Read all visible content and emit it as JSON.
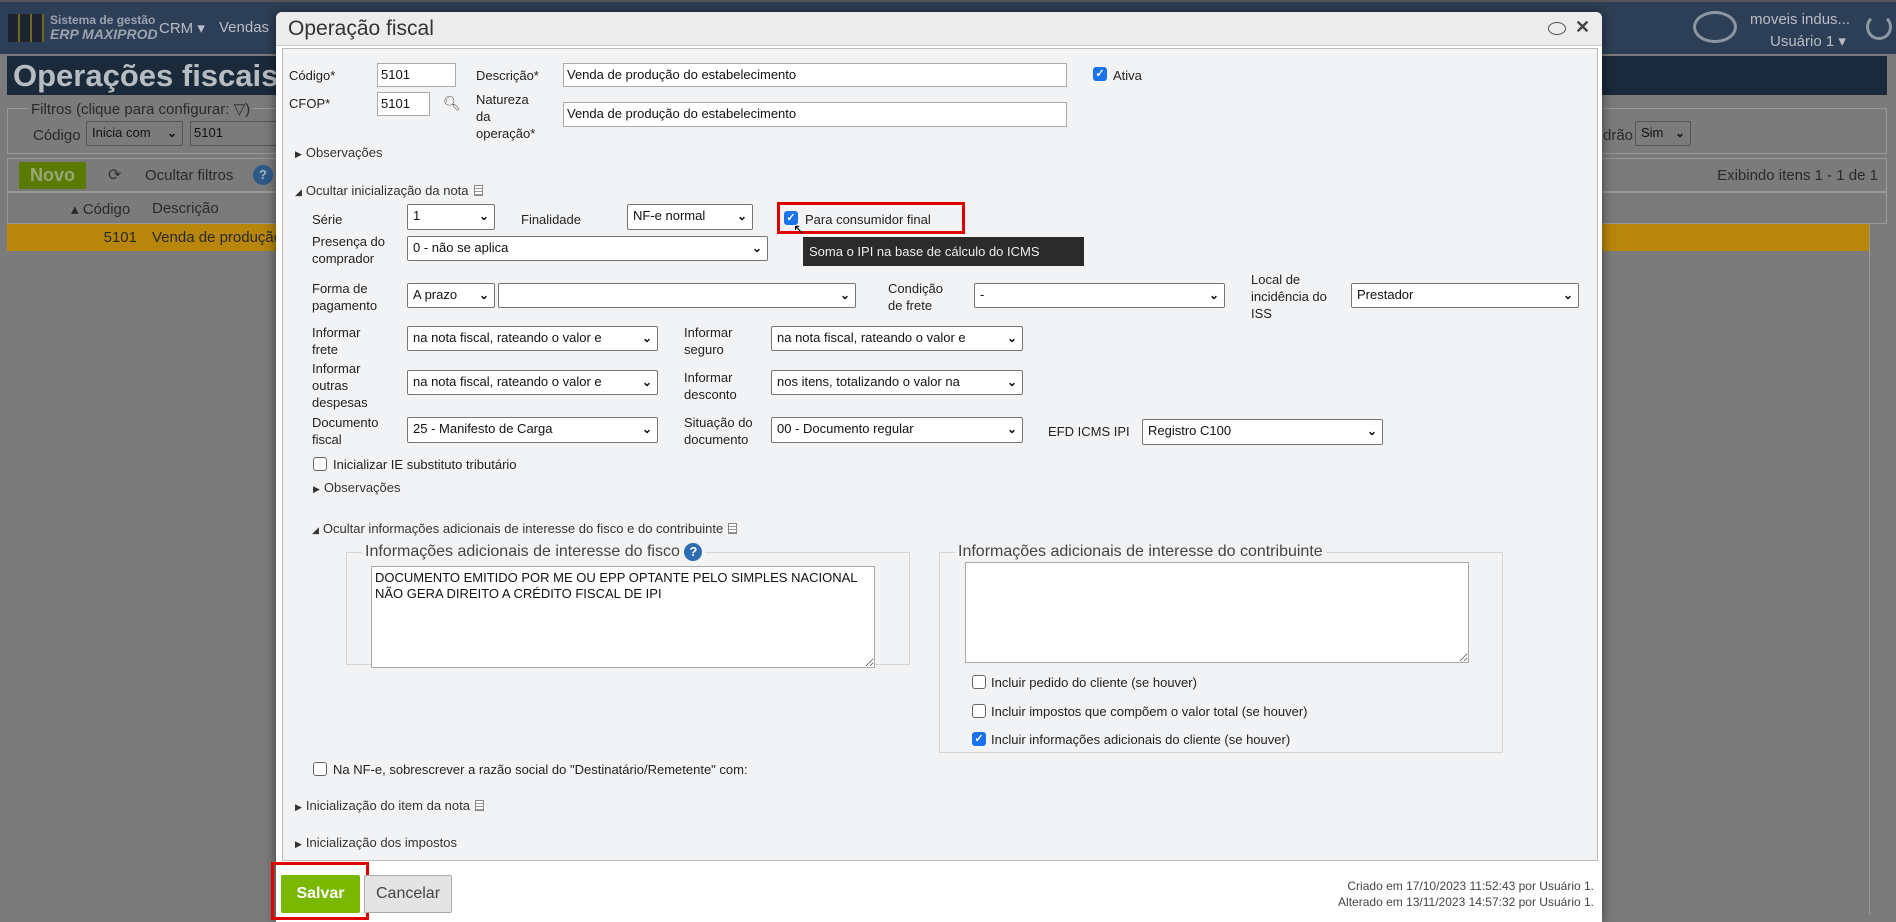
{
  "background": {
    "brand_line1": "Sistema de gestão",
    "brand_line2": "ERP MAXIPROD",
    "menu": [
      "CRM",
      "Vendas"
    ],
    "company": "moveis indus...",
    "user": "Usuário 1",
    "page_title": "Operações fiscais",
    "filters_legend": "Filtros (clique para configurar:",
    "filter_code_label": "Código",
    "filter_code_mode": "Inicia com",
    "filter_code_value": "5101",
    "filter_default_label": "drão",
    "filter_default_value": "Sim",
    "new_button": "Novo",
    "hide_filters": "Ocultar filtros",
    "showing": "Exibindo itens 1 - 1 de 1",
    "columns": [
      "Código",
      "Descrição"
    ],
    "row": {
      "code": "5101",
      "description": "Venda de produção"
    }
  },
  "dialog": {
    "title": "Operação fiscal",
    "codigo_label": "Código*",
    "codigo": "5101",
    "descricao_label": "Descrição*",
    "descricao": "Venda de produção do estabelecimento",
    "ativa_label": "Ativa",
    "ativa": true,
    "cfop_label": "CFOP*",
    "cfop": "5101",
    "natureza_label": [
      "Natureza",
      "da",
      "operação*"
    ],
    "natureza": "Venda de produção do estabelecimento",
    "observacoes": "Observações",
    "nota_section": "Ocultar inicialização da nota",
    "serie_label": "Série",
    "serie": "1",
    "finalidade_label": "Finalidade",
    "finalidade": "NF-e normal",
    "consumidor_final_label": "Para consumidor final",
    "consumidor_final": true,
    "tooltip": "Soma o IPI na base de cálculo do ICMS",
    "presenca_label": [
      "Presença do",
      "comprador"
    ],
    "presenca": "0 - não se aplica",
    "forma_pagamento_label": [
      "Forma de",
      "pagamento"
    ],
    "forma_pagamento": "A prazo",
    "forma_pagamento_2": "",
    "condicao_frete_label": [
      "Condição",
      "de frete"
    ],
    "condicao_frete": "-",
    "local_iss_label": [
      "Local de",
      "incidência do",
      "ISS"
    ],
    "local_iss": "Prestador",
    "frete_label": [
      "Informar",
      "frete"
    ],
    "frete": "na nota fiscal, rateando o valor e",
    "seguro_label": [
      "Informar",
      "seguro"
    ],
    "seguro": "na nota fiscal, rateando o valor e",
    "outras_label": [
      "Informar",
      "outras",
      "despesas"
    ],
    "outras": "na nota fiscal, rateando o valor e",
    "desconto_label": [
      "Informar",
      "desconto"
    ],
    "desconto": "nos itens, totalizando o valor na",
    "documento_label": [
      "Documento",
      "fiscal"
    ],
    "documento": "25 - Manifesto de Carga",
    "situacao_label": [
      "Situação do",
      "documento"
    ],
    "situacao": "00 - Documento regular",
    "efd_label": "EFD ICMS IPI",
    "efd": "Registro C100",
    "ie_substituto_label": "Inicializar IE substituto tributário",
    "ie_substituto": false,
    "observacoes_2": "Observações",
    "info_section": "Ocultar informações adicionais de interesse do fisco e do contribuinte",
    "fisco_legend": "Informações adicionais de interesse do fisco",
    "fisco_text": "DOCUMENTO EMITIDO POR ME OU EPP OPTANTE PELO SIMPLES NACIONAL NÃO GERA DIREITO A CRÉDITO FISCAL DE IPI",
    "contribuinte_legend": "Informações adicionais de interesse do contribuinte",
    "contribuinte_text": "",
    "contrib_checks": [
      {
        "label": "Incluir pedido do cliente (se houver)",
        "checked": false
      },
      {
        "label": "Incluir impostos que compõem o valor total (se houver)",
        "checked": false
      },
      {
        "label": "Incluir informações adicionais do cliente (se houver)",
        "checked": true
      }
    ],
    "sobrescrever_label": "Na NF-e, sobrescrever a razão social do \"Destinatário/Remetente\" com:",
    "sobrescrever": false,
    "item_section": "Inicialização do item da nota",
    "impostos_section": "Inicialização dos impostos",
    "save": "Salvar",
    "cancel": "Cancelar",
    "created": "Criado em 17/10/2023 11:52:43 por Usuário 1.",
    "modified": "Alterado em 13/11/2023 14:57:32 por Usuário 1."
  },
  "colors": {
    "save": "#7ab800",
    "highlight": "#e00000",
    "row_selected": "#b7860b"
  }
}
